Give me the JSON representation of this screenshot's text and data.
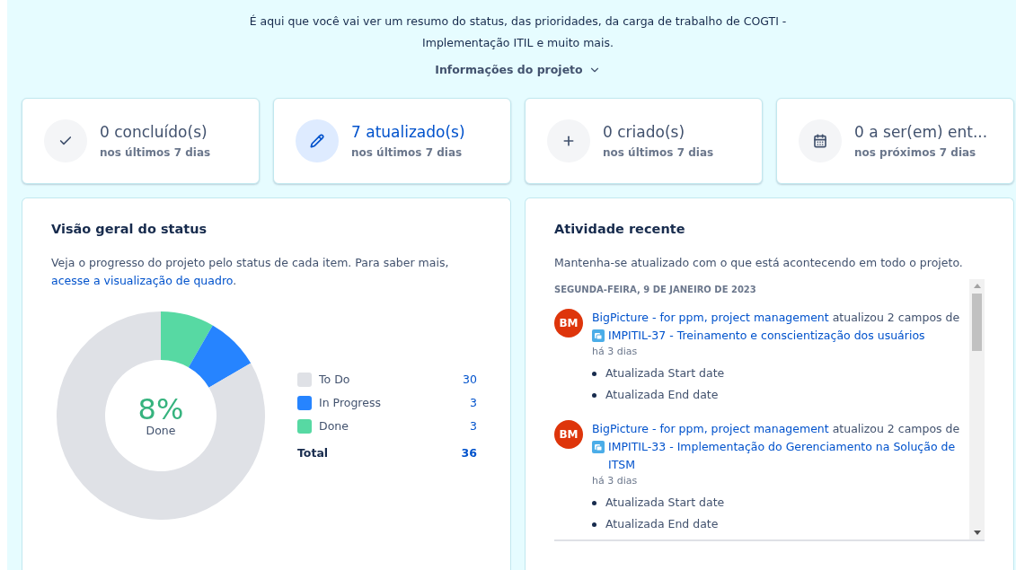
{
  "header": {
    "description": "É aqui que você vai ver um resumo do status, das prioridades, da carga de trabalho de COGTI - Implementação ITIL e muito mais.",
    "project_info": {
      "label": "Informações do projeto",
      "expanded": false
    }
  },
  "stat_cards": [
    {
      "title": "0 concluído(s)",
      "subtitle": "nos últimos 7 dias",
      "selected": false
    },
    {
      "title": "7 atualizado(s)",
      "subtitle": "nos últimos 7 dias",
      "selected": true
    },
    {
      "title": "0 criado(s)",
      "subtitle": "nos últimos 7 dias",
      "selected": false
    },
    {
      "title": "0 a ser(em) ent...",
      "subtitle": "nos próximos 7 dias",
      "selected": false
    }
  ],
  "status_overview": {
    "title": "Visão geral do status",
    "description": "Veja o progresso do projeto pelo status de cada item. Para saber mais,",
    "link": "acesse a visualização de quadro",
    "link_suffix": ".",
    "center_value": "8%",
    "center_label": "Done",
    "chart_data": {
      "type": "donut",
      "values": [
        8.3,
        8.3,
        83.4
      ]
    },
    "legend": [
      {
        "label": "To Do",
        "count": "30",
        "color": "#dfe1e6"
      },
      {
        "label": "In Progress",
        "count": "3",
        "color": "#2684ff"
      },
      {
        "label": "Done",
        "count": "3",
        "color": "#57d9a3"
      }
    ],
    "total": {
      "label": "Total",
      "count": "36"
    }
  },
  "recent_activity": {
    "title": "Atividade recente",
    "description": "Mantenha-se atualizado com o que está acontecendo em todo o projeto.",
    "date": "SEGUNDA-FEIRA, 9 DE JANEIRO DE 2023",
    "items": [
      {
        "avatar": "BM",
        "actor": "BigPicture - for ppm, project management",
        "action": " atualizou 2 campos de",
        "issue": "IMPITIL-37 - Treinamento e conscientização dos usuários",
        "time": "há 3 dias",
        "changes": [
          "Atualizada Start date",
          "Atualizada End date"
        ]
      },
      {
        "avatar": "BM",
        "actor": "BigPicture - for ppm, project management",
        "action": " atualizou 2 campos de",
        "issue": "IMPITIL-33 - Implementação do Gerenciamento na Solução de ITSM",
        "time": "há 3 dias",
        "changes": [
          "Atualizada Start date",
          "Atualizada End date"
        ]
      }
    ]
  }
}
